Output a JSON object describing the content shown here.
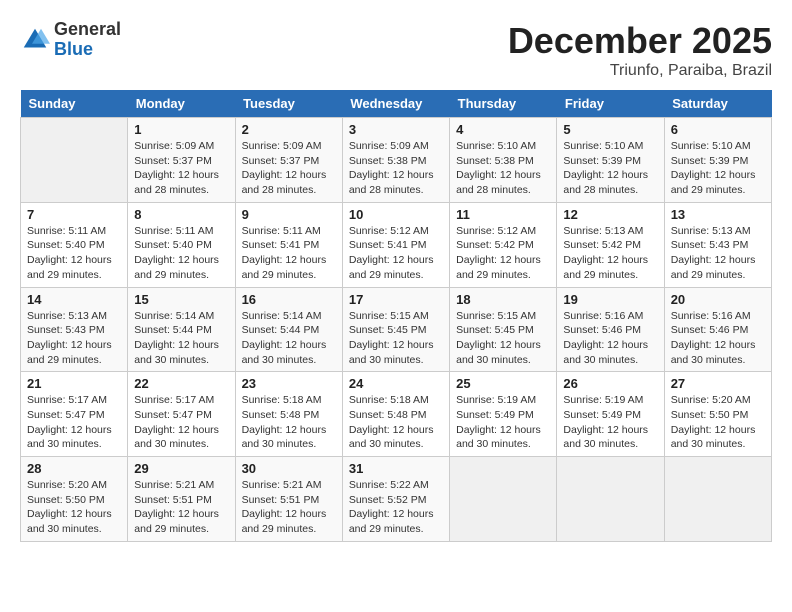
{
  "header": {
    "logo_general": "General",
    "logo_blue": "Blue",
    "month_title": "December 2025",
    "location": "Triunfo, Paraiba, Brazil"
  },
  "weekdays": [
    "Sunday",
    "Monday",
    "Tuesday",
    "Wednesday",
    "Thursday",
    "Friday",
    "Saturday"
  ],
  "weeks": [
    [
      {
        "day": "",
        "info": ""
      },
      {
        "day": "1",
        "info": "Sunrise: 5:09 AM\nSunset: 5:37 PM\nDaylight: 12 hours\nand 28 minutes."
      },
      {
        "day": "2",
        "info": "Sunrise: 5:09 AM\nSunset: 5:37 PM\nDaylight: 12 hours\nand 28 minutes."
      },
      {
        "day": "3",
        "info": "Sunrise: 5:09 AM\nSunset: 5:38 PM\nDaylight: 12 hours\nand 28 minutes."
      },
      {
        "day": "4",
        "info": "Sunrise: 5:10 AM\nSunset: 5:38 PM\nDaylight: 12 hours\nand 28 minutes."
      },
      {
        "day": "5",
        "info": "Sunrise: 5:10 AM\nSunset: 5:39 PM\nDaylight: 12 hours\nand 28 minutes."
      },
      {
        "day": "6",
        "info": "Sunrise: 5:10 AM\nSunset: 5:39 PM\nDaylight: 12 hours\nand 29 minutes."
      }
    ],
    [
      {
        "day": "7",
        "info": "Sunrise: 5:11 AM\nSunset: 5:40 PM\nDaylight: 12 hours\nand 29 minutes."
      },
      {
        "day": "8",
        "info": "Sunrise: 5:11 AM\nSunset: 5:40 PM\nDaylight: 12 hours\nand 29 minutes."
      },
      {
        "day": "9",
        "info": "Sunrise: 5:11 AM\nSunset: 5:41 PM\nDaylight: 12 hours\nand 29 minutes."
      },
      {
        "day": "10",
        "info": "Sunrise: 5:12 AM\nSunset: 5:41 PM\nDaylight: 12 hours\nand 29 minutes."
      },
      {
        "day": "11",
        "info": "Sunrise: 5:12 AM\nSunset: 5:42 PM\nDaylight: 12 hours\nand 29 minutes."
      },
      {
        "day": "12",
        "info": "Sunrise: 5:13 AM\nSunset: 5:42 PM\nDaylight: 12 hours\nand 29 minutes."
      },
      {
        "day": "13",
        "info": "Sunrise: 5:13 AM\nSunset: 5:43 PM\nDaylight: 12 hours\nand 29 minutes."
      }
    ],
    [
      {
        "day": "14",
        "info": "Sunrise: 5:13 AM\nSunset: 5:43 PM\nDaylight: 12 hours\nand 29 minutes."
      },
      {
        "day": "15",
        "info": "Sunrise: 5:14 AM\nSunset: 5:44 PM\nDaylight: 12 hours\nand 30 minutes."
      },
      {
        "day": "16",
        "info": "Sunrise: 5:14 AM\nSunset: 5:44 PM\nDaylight: 12 hours\nand 30 minutes."
      },
      {
        "day": "17",
        "info": "Sunrise: 5:15 AM\nSunset: 5:45 PM\nDaylight: 12 hours\nand 30 minutes."
      },
      {
        "day": "18",
        "info": "Sunrise: 5:15 AM\nSunset: 5:45 PM\nDaylight: 12 hours\nand 30 minutes."
      },
      {
        "day": "19",
        "info": "Sunrise: 5:16 AM\nSunset: 5:46 PM\nDaylight: 12 hours\nand 30 minutes."
      },
      {
        "day": "20",
        "info": "Sunrise: 5:16 AM\nSunset: 5:46 PM\nDaylight: 12 hours\nand 30 minutes."
      }
    ],
    [
      {
        "day": "21",
        "info": "Sunrise: 5:17 AM\nSunset: 5:47 PM\nDaylight: 12 hours\nand 30 minutes."
      },
      {
        "day": "22",
        "info": "Sunrise: 5:17 AM\nSunset: 5:47 PM\nDaylight: 12 hours\nand 30 minutes."
      },
      {
        "day": "23",
        "info": "Sunrise: 5:18 AM\nSunset: 5:48 PM\nDaylight: 12 hours\nand 30 minutes."
      },
      {
        "day": "24",
        "info": "Sunrise: 5:18 AM\nSunset: 5:48 PM\nDaylight: 12 hours\nand 30 minutes."
      },
      {
        "day": "25",
        "info": "Sunrise: 5:19 AM\nSunset: 5:49 PM\nDaylight: 12 hours\nand 30 minutes."
      },
      {
        "day": "26",
        "info": "Sunrise: 5:19 AM\nSunset: 5:49 PM\nDaylight: 12 hours\nand 30 minutes."
      },
      {
        "day": "27",
        "info": "Sunrise: 5:20 AM\nSunset: 5:50 PM\nDaylight: 12 hours\nand 30 minutes."
      }
    ],
    [
      {
        "day": "28",
        "info": "Sunrise: 5:20 AM\nSunset: 5:50 PM\nDaylight: 12 hours\nand 30 minutes."
      },
      {
        "day": "29",
        "info": "Sunrise: 5:21 AM\nSunset: 5:51 PM\nDaylight: 12 hours\nand 29 minutes."
      },
      {
        "day": "30",
        "info": "Sunrise: 5:21 AM\nSunset: 5:51 PM\nDaylight: 12 hours\nand 29 minutes."
      },
      {
        "day": "31",
        "info": "Sunrise: 5:22 AM\nSunset: 5:52 PM\nDaylight: 12 hours\nand 29 minutes."
      },
      {
        "day": "",
        "info": ""
      },
      {
        "day": "",
        "info": ""
      },
      {
        "day": "",
        "info": ""
      }
    ]
  ]
}
